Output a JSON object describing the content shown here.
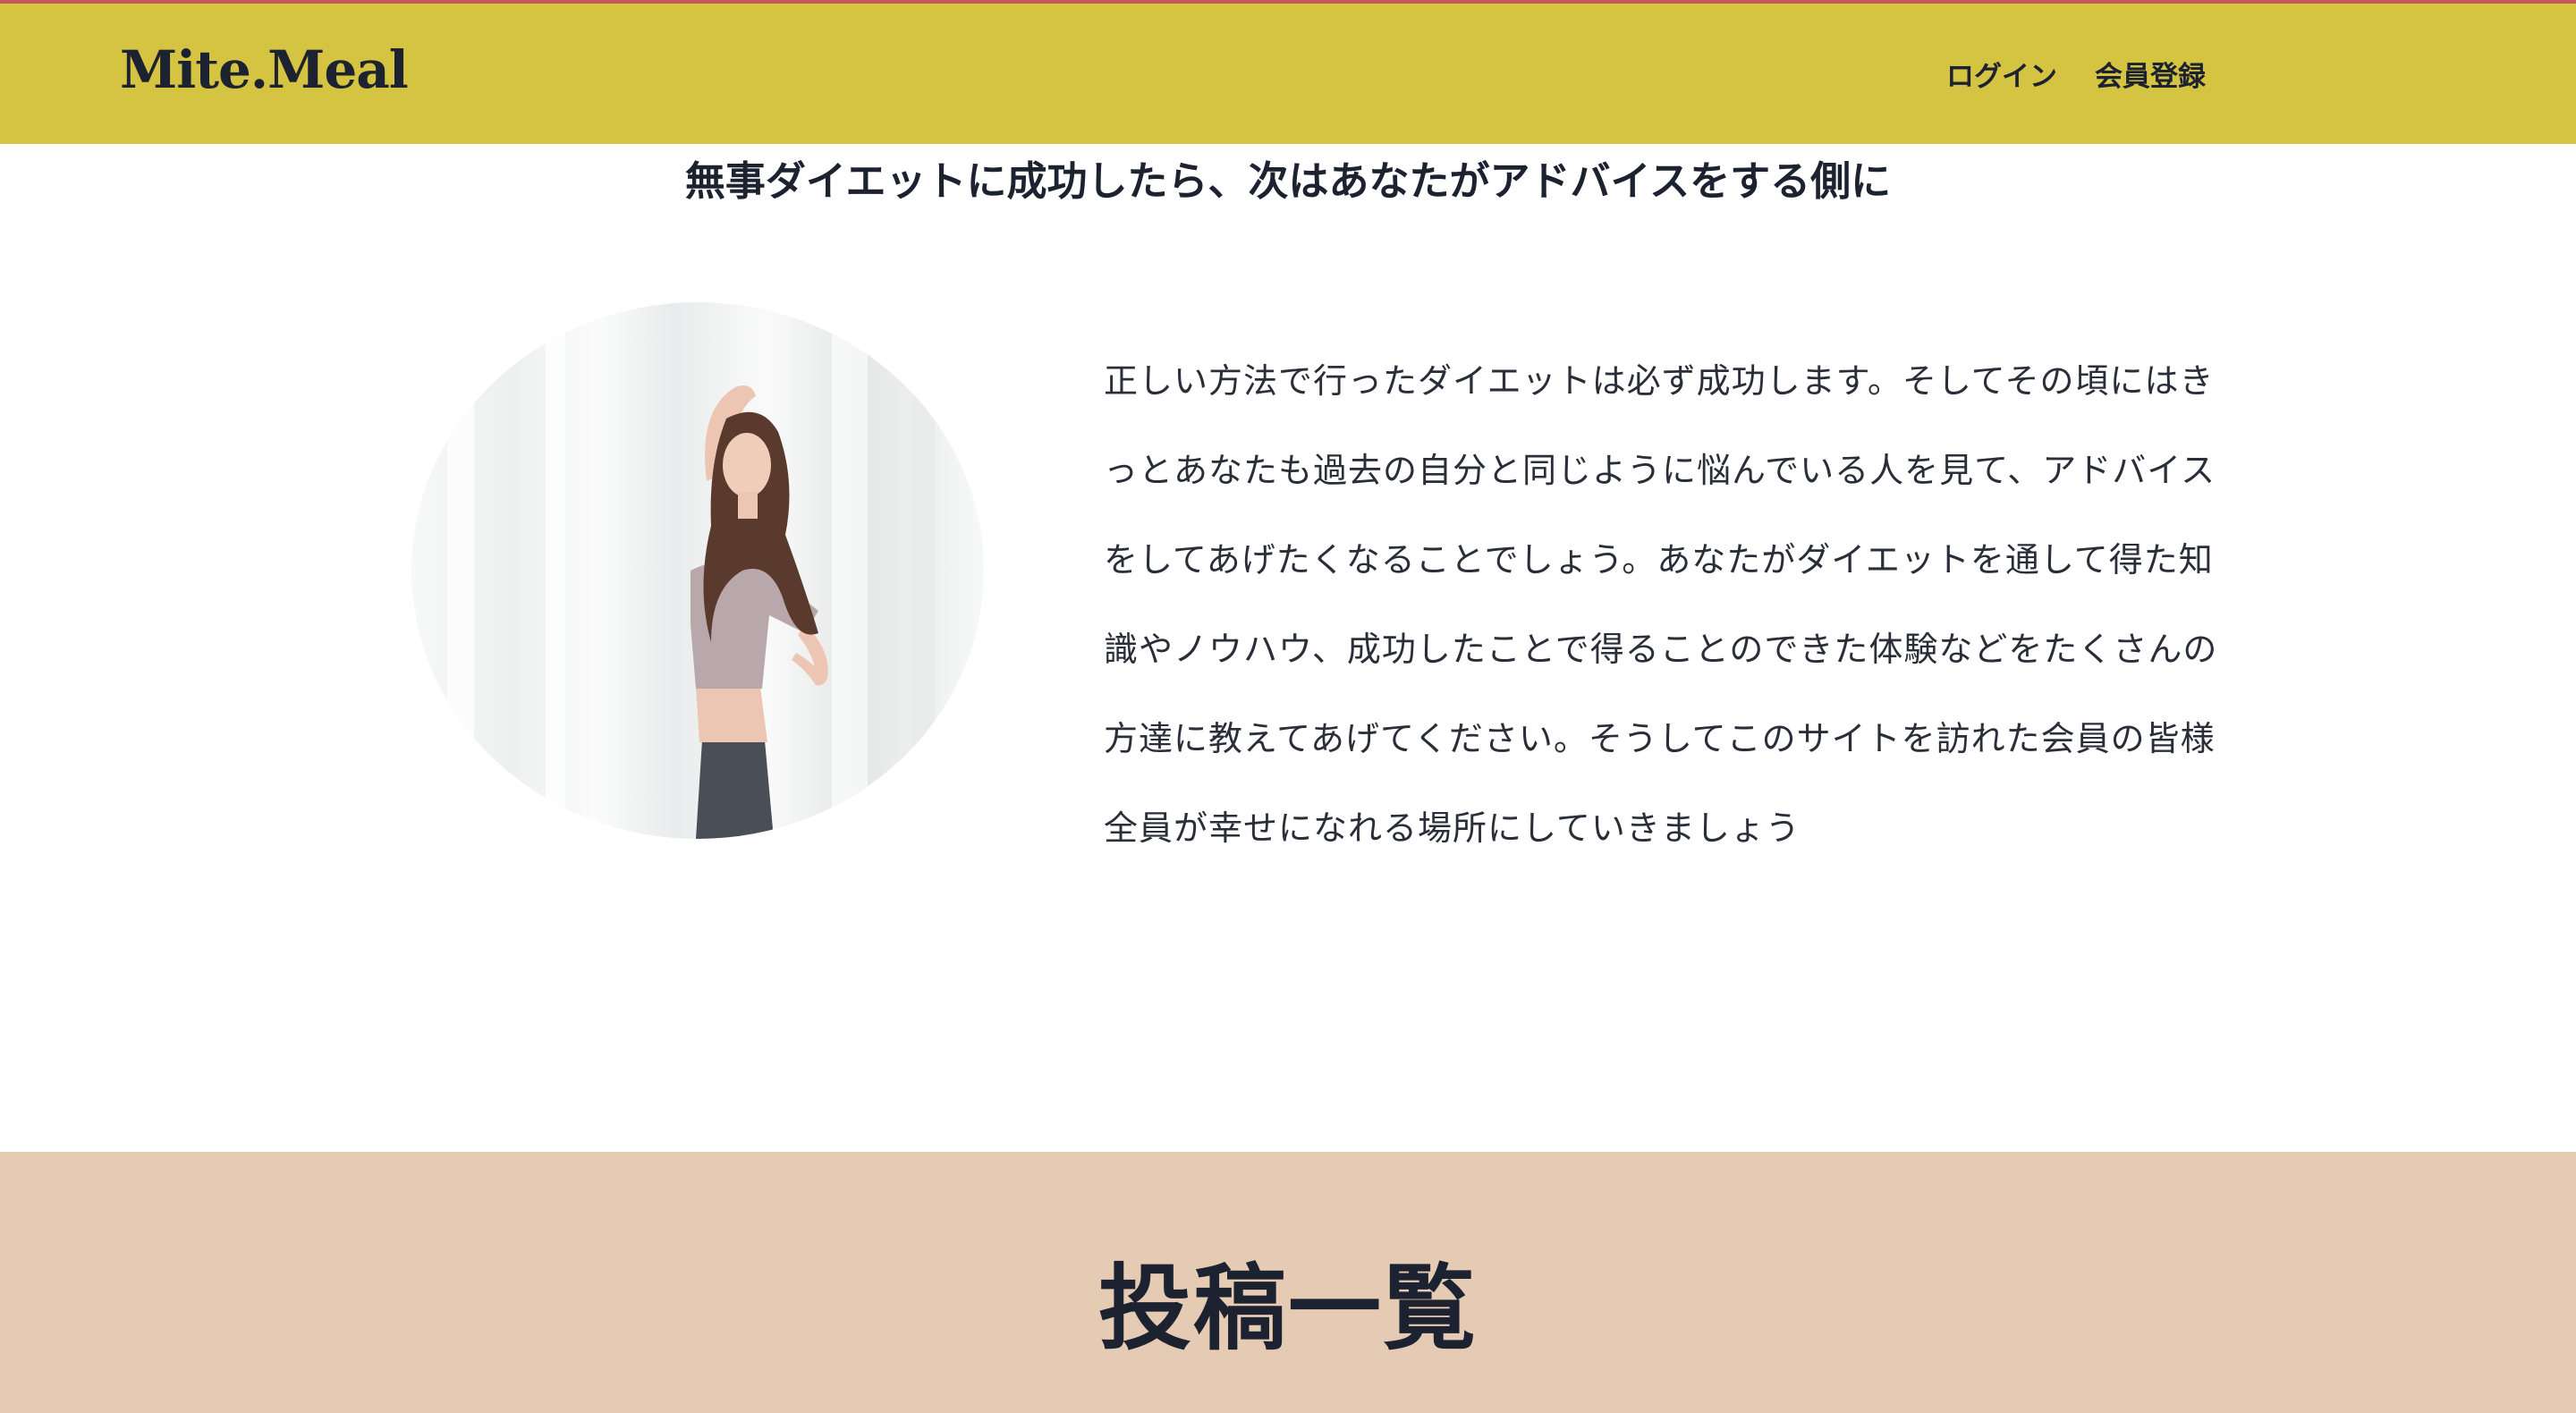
{
  "header": {
    "logo": "Mite.Meal",
    "nav": {
      "login": "ログイン",
      "signup": "会員登録"
    }
  },
  "intro": {
    "heading": "無事ダイエットに成功したら、次はあなたがアドバイスをする側に",
    "body": "正しい方法で行ったダイエットは必ず成功します。そしてその頃にはき\nっとあなたも過去の自分と同じように悩んでいる人を見て、アドバイス\nをしてあげたくなることでしょう。あなたがダイエットを通して得た知\n識やノウハウ、成功したことで得ることのできた体験などをたくさんの\n方達に教えてあげてください。そうしてこのサイトを訪れた会員の皆様\n全員が幸せになれる場所にしていきましょう"
  },
  "posts": {
    "title": "投稿一覧"
  },
  "colors": {
    "header": "#d4c442",
    "posts_bg": "#e5cbb4",
    "text": "#1d2230"
  }
}
